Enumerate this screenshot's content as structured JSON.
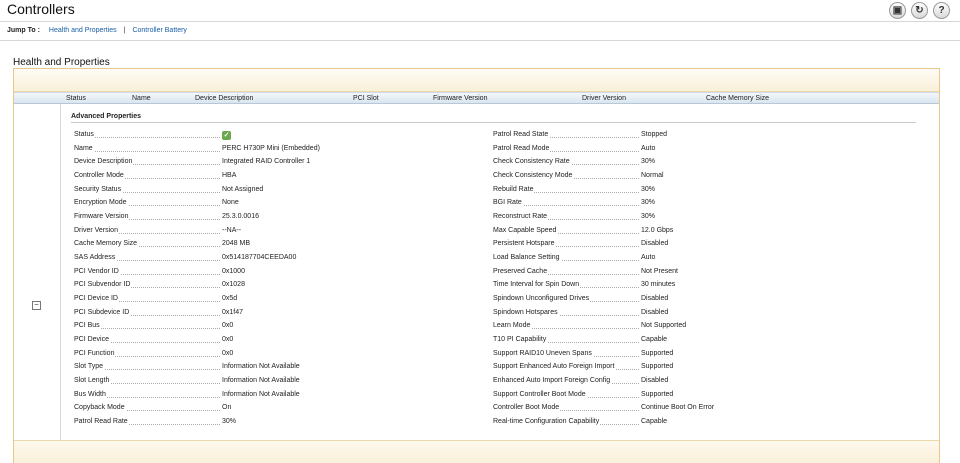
{
  "page": {
    "title": "Controllers"
  },
  "header_icons": [
    {
      "name": "print-icon",
      "glyph": "▣"
    },
    {
      "name": "refresh-icon",
      "glyph": "↻"
    },
    {
      "name": "help-icon",
      "glyph": "?"
    }
  ],
  "jump": {
    "label": "Jump To :",
    "link1": "Health and Properties",
    "separator": "|",
    "link2": "Controller Battery"
  },
  "section": {
    "title": "Health and Properties"
  },
  "columns": [
    "Status",
    "Name",
    "Device Description",
    "PCI Slot",
    "Firmware Version",
    "Driver Version",
    "Cache Memory Size"
  ],
  "toggle": "−",
  "advanced": {
    "title": "Advanced Properties",
    "status_icon": "check-icon",
    "status_color": "#6aa84f",
    "left": [
      {
        "label": "Status",
        "value": ""
      },
      {
        "label": "Name",
        "value": "PERC H730P Mini (Embedded)"
      },
      {
        "label": "Device Description",
        "value": "Integrated RAID Controller 1"
      },
      {
        "label": "Controller Mode",
        "value": "HBA"
      },
      {
        "label": "Security Status",
        "value": "Not Assigned"
      },
      {
        "label": "Encryption Mode",
        "value": "None"
      },
      {
        "label": "Firmware Version",
        "value": "25.3.0.0016"
      },
      {
        "label": "Driver Version",
        "value": "--NA--"
      },
      {
        "label": "Cache Memory Size",
        "value": "2048 MB"
      },
      {
        "label": "SAS Address",
        "value": "0x514187704CEEDA00"
      },
      {
        "label": "PCI Vendor ID",
        "value": "0x1000"
      },
      {
        "label": "PCI Subvendor ID",
        "value": "0x1028"
      },
      {
        "label": "PCI Device ID",
        "value": "0x5d"
      },
      {
        "label": "PCI Subdevice ID",
        "value": "0x1f47"
      },
      {
        "label": "PCI Bus",
        "value": "0x0"
      },
      {
        "label": "PCI Device",
        "value": "0x0"
      },
      {
        "label": "PCI Function",
        "value": "0x0"
      },
      {
        "label": "Slot Type",
        "value": "Information Not Available"
      },
      {
        "label": "Slot Length",
        "value": "Information Not Available"
      },
      {
        "label": "Bus Width",
        "value": "Information Not Available"
      },
      {
        "label": "Copyback Mode",
        "value": "On"
      },
      {
        "label": "Patrol Read Rate",
        "value": "30%"
      }
    ],
    "right": [
      {
        "label": "Patrol Read State",
        "value": "Stopped"
      },
      {
        "label": "Patrol Read Mode",
        "value": "Auto"
      },
      {
        "label": "Check Consistency Rate",
        "value": "30%"
      },
      {
        "label": "Check Consistency Mode",
        "value": "Normal"
      },
      {
        "label": "Rebuild Rate",
        "value": "30%"
      },
      {
        "label": "BGI Rate",
        "value": "30%"
      },
      {
        "label": "Reconstruct Rate",
        "value": "30%"
      },
      {
        "label": "Max Capable Speed",
        "value": "12.0 Gbps"
      },
      {
        "label": "Persistent Hotspare",
        "value": "Disabled"
      },
      {
        "label": "Load Balance Setting",
        "value": "Auto"
      },
      {
        "label": "Preserved Cache",
        "value": "Not Present"
      },
      {
        "label": "Time Interval for Spin Down",
        "value": "30 minutes"
      },
      {
        "label": "Spindown Unconfigured Drives",
        "value": "Disabled"
      },
      {
        "label": "Spindown Hotspares",
        "value": "Disabled"
      },
      {
        "label": "Learn Mode",
        "value": "Not Supported"
      },
      {
        "label": "T10 PI Capability",
        "value": "Capable"
      },
      {
        "label": "Support RAID10 Uneven Spans",
        "value": "Supported"
      },
      {
        "label": "Support Enhanced Auto Foreign Import",
        "value": "Supported"
      },
      {
        "label": "Enhanced Auto Import Foreign Config",
        "value": "Disabled"
      },
      {
        "label": "Support Controller Boot Mode",
        "value": "Supported"
      },
      {
        "label": "Controller Boot Mode",
        "value": "Continue Boot On Error"
      },
      {
        "label": "Real-time Configuration Capability",
        "value": "Capable"
      }
    ]
  }
}
